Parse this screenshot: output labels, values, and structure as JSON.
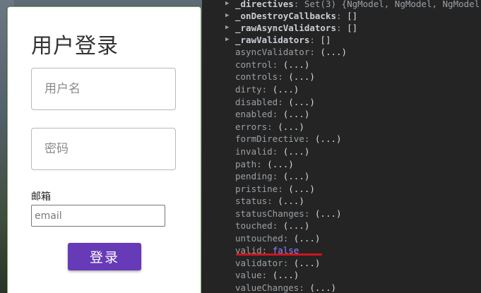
{
  "login": {
    "title": "用户登录",
    "username_placeholder": "用户名",
    "password_placeholder": "密码",
    "email_label": "邮箱",
    "email_placeholder": "email",
    "submit_label": "登录"
  },
  "devtools": {
    "rows": [
      {
        "key": "_directives",
        "sep": ": ",
        "val": "Set(3) {NgModel, NgModel, NgModel",
        "expandable": true,
        "bold": true,
        "dim_val": true
      },
      {
        "key": "_onDestroyCallbacks",
        "sep": ": ",
        "val": "[]",
        "expandable": true,
        "bold": true
      },
      {
        "key": "_rawAsyncValidators",
        "sep": ": ",
        "val": "[]",
        "expandable": true,
        "bold": true
      },
      {
        "key": "_rawValidators",
        "sep": ": ",
        "val": "[]",
        "expandable": true,
        "bold": true
      },
      {
        "key": "asyncValidator",
        "sep": ": ",
        "val": "(...)"
      },
      {
        "key": "control",
        "sep": ": ",
        "val": "(...)"
      },
      {
        "key": "controls",
        "sep": ": ",
        "val": "(...)"
      },
      {
        "key": "dirty",
        "sep": ": ",
        "val": "(...)"
      },
      {
        "key": "disabled",
        "sep": ": ",
        "val": "(...)"
      },
      {
        "key": "enabled",
        "sep": ": ",
        "val": "(...)"
      },
      {
        "key": "errors",
        "sep": ": ",
        "val": "(...)"
      },
      {
        "key": "formDirective",
        "sep": ": ",
        "val": "(...)"
      },
      {
        "key": "invalid",
        "sep": ": ",
        "val": "(...)"
      },
      {
        "key": "path",
        "sep": ": ",
        "val": "(...)"
      },
      {
        "key": "pending",
        "sep": ": ",
        "val": "(...)"
      },
      {
        "key": "pristine",
        "sep": ": ",
        "val": "(...)"
      },
      {
        "key": "status",
        "sep": ": ",
        "val": "(...)"
      },
      {
        "key": "statusChanges",
        "sep": ": ",
        "val": "(...)"
      },
      {
        "key": "touched",
        "sep": ": ",
        "val": "(...)"
      },
      {
        "key": "untouched",
        "sep": ": ",
        "val": "(...)"
      },
      {
        "key": "valid",
        "sep": ": ",
        "val": "false",
        "is_false": true
      },
      {
        "key": "validator",
        "sep": ": ",
        "val": "(...)"
      },
      {
        "key": "value",
        "sep": ": ",
        "val": "(...)"
      },
      {
        "key": "valueChanges",
        "sep": ": ",
        "val": "(...)"
      }
    ]
  },
  "colors": {
    "button": "#673ab7",
    "false_value": "#8f86ff",
    "underline": "#d0151e"
  }
}
